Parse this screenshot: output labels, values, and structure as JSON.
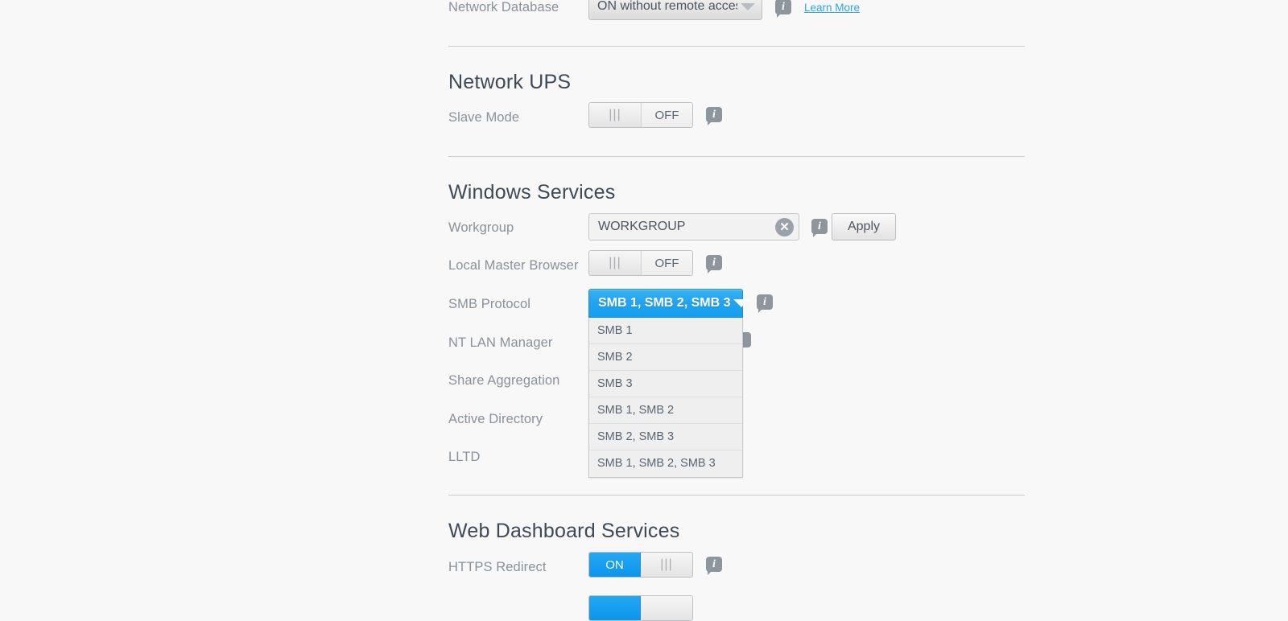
{
  "sections": [
    {
      "id": "network-database-row",
      "label": "Network Database",
      "control": "select",
      "value": "ON without remote access",
      "learn_more": "Learn More"
    },
    {
      "id": "network-ups",
      "title": "Network UPS",
      "rows": [
        {
          "label": "Slave Mode",
          "toggle_state": "OFF",
          "toggle_label": "OFF"
        }
      ]
    },
    {
      "id": "windows-services",
      "title": "Windows Services",
      "rows": [
        {
          "label": "Workgroup",
          "value": "WORKGROUP",
          "apply_label": "Apply"
        },
        {
          "label": "Local Master Browser",
          "toggle_state": "OFF",
          "toggle_label": "OFF"
        },
        {
          "label": "SMB Protocol",
          "value": "SMB 1, SMB 2, SMB 3"
        },
        {
          "label": "NT LAN Manager"
        },
        {
          "label": "Share Aggregation"
        },
        {
          "label": "Active Directory"
        },
        {
          "label": "LLTD"
        }
      ]
    },
    {
      "id": "web-dashboard-services",
      "title": "Web Dashboard Services",
      "rows": [
        {
          "label": "HTTPS Redirect",
          "toggle_state": "ON",
          "toggle_label": "ON"
        }
      ]
    }
  ],
  "labels": {
    "network_database": "Network Database",
    "network_ups_title": "Network UPS",
    "slave_mode": "Slave Mode",
    "windows_services_title": "Windows Services",
    "workgroup": "Workgroup",
    "local_master_browser": "Local Master Browser",
    "smb_protocol": "SMB Protocol",
    "nt_lan_manager": "NT LAN Manager",
    "share_aggregation": "Share Aggregation",
    "active_directory": "Active Directory",
    "lltd": "LLTD",
    "web_dashboard_title": "Web Dashboard Services",
    "https_redirect": "HTTPS Redirect"
  },
  "values": {
    "network_database": "ON without remote access",
    "workgroup": "WORKGROUP",
    "smb_protocol": "SMB 1, SMB 2, SMB 3"
  },
  "buttons": {
    "apply": "Apply",
    "learn_more": "Learn More",
    "clear_x": "✕"
  },
  "toggles": {
    "slave_mode": "OFF",
    "local_master_browser": "OFF",
    "https_redirect": "ON",
    "grip": "|||"
  },
  "smb_dropdown": {
    "open": true,
    "selected": "SMB 1, SMB 2, SMB 3",
    "options": [
      "SMB 1",
      "SMB 2",
      "SMB 3",
      "SMB 1, SMB 2",
      "SMB 2, SMB 3",
      "SMB 1, SMB 2, SMB 3"
    ]
  },
  "icons": {
    "info": "i",
    "caret_down": "▼"
  },
  "colors": {
    "page_background": "#f8f8f8",
    "accent_blue": "#11a0f0",
    "link_blue": "#2fa4e7",
    "label_gray": "#8a9199",
    "title_gray": "#3f4a56",
    "info_icon_gray": "#8d959d",
    "divider_gray": "#c9cdd1"
  }
}
